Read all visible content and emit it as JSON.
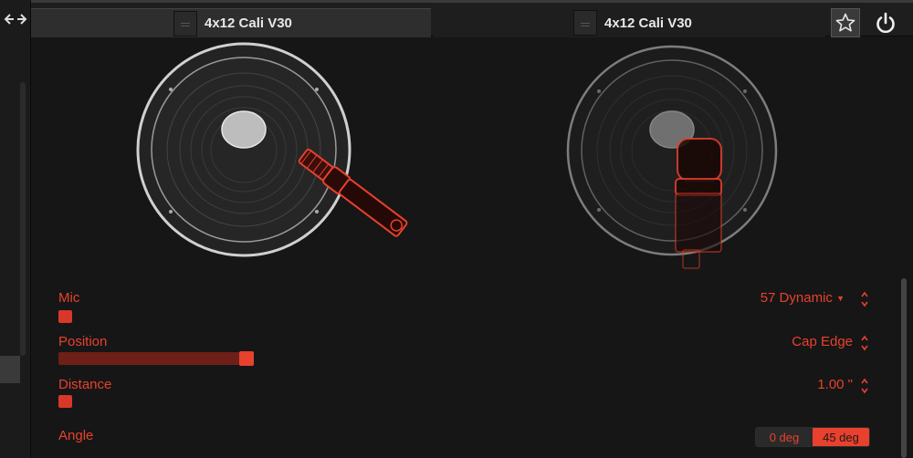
{
  "window": {
    "cab_a": {
      "title": "4x12 Cali V30"
    },
    "cab_b": {
      "title": "4x12 Cali V30"
    }
  },
  "icons": {
    "swap": "swap-arrows-icon",
    "favorite": "star-icon",
    "power": "power-icon",
    "handle": "grip-icon"
  },
  "params": {
    "mic": {
      "label": "Mic",
      "value": "57 Dynamic"
    },
    "position": {
      "label": "Position",
      "value": "Cap Edge",
      "level": 1.0
    },
    "distance": {
      "label": "Distance",
      "value": "1.00 \""
    },
    "angle": {
      "label": "Angle",
      "options": [
        "0 deg",
        "45 deg"
      ],
      "selected": "45 deg"
    }
  },
  "colors": {
    "accent": "#e8412e",
    "background": "#161616"
  }
}
